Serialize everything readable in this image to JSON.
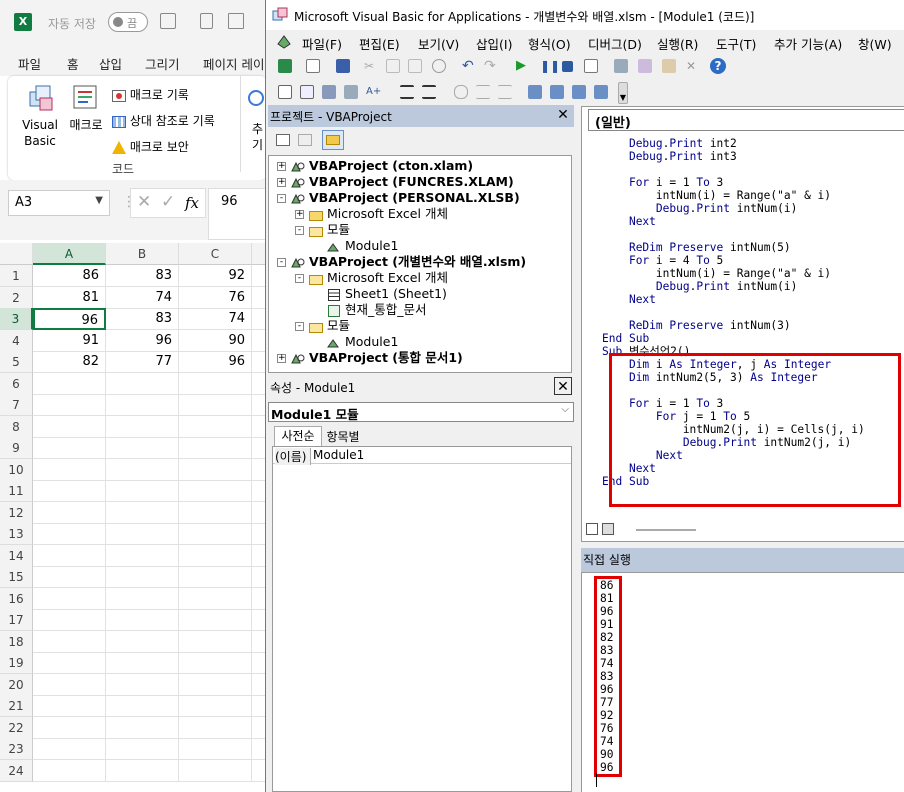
{
  "excel": {
    "autosave_label": "자동 저장",
    "autosave_state": "끔",
    "tabs": [
      "파일",
      "홈",
      "삽입",
      "그리기",
      "페이지 레이"
    ],
    "ribbon": {
      "visual_basic": [
        "Visual",
        "Basic"
      ],
      "macro": "매크로",
      "record_macro": "매크로 기록",
      "relative_ref": "상대 참조로 기록",
      "macro_security": "매크로 보안",
      "group_label": "코드",
      "cut_label_1": "추",
      "cut_label_2": "기"
    },
    "name_box": "A3",
    "fx": "fx",
    "formula_value": "96",
    "columns": [
      "A",
      "B",
      "C"
    ],
    "rows": [
      "1",
      "2",
      "3",
      "4",
      "5",
      "6",
      "7",
      "8",
      "9",
      "10",
      "11",
      "12",
      "13",
      "14",
      "15",
      "16",
      "17",
      "18",
      "19",
      "20",
      "21",
      "22",
      "23",
      "24"
    ],
    "cells": [
      [
        "86",
        "83",
        "92"
      ],
      [
        "81",
        "74",
        "76"
      ],
      [
        "96",
        "83",
        "74"
      ],
      [
        "91",
        "96",
        "90"
      ],
      [
        "82",
        "77",
        "96"
      ]
    ]
  },
  "vbe": {
    "title": "Microsoft Visual Basic for Applications - 개별변수와 배열.xlsm - [Module1 (코드)]",
    "menu": [
      "파일(F)",
      "편집(E)",
      "보기(V)",
      "삽입(I)",
      "형식(O)",
      "디버그(D)",
      "실행(R)",
      "도구(T)",
      "추가 기능(A)",
      "창(W)"
    ],
    "project_title": "프로젝트 - VBAProject",
    "tree": [
      {
        "label": "VBAProject (cton.xlam)",
        "level": 0,
        "bold": true,
        "pm": "+",
        "icon": "vbaproject-icon"
      },
      {
        "label": "VBAProject (FUNCRES.XLAM)",
        "level": 0,
        "bold": true,
        "pm": "+",
        "icon": "vbaproject-icon"
      },
      {
        "label": "VBAProject (PERSONAL.XLSB)",
        "level": 0,
        "bold": true,
        "pm": "-",
        "icon": "vbaproject-icon"
      },
      {
        "label": "Microsoft Excel 개체",
        "level": 1,
        "bold": false,
        "pm": "+",
        "icon": "folder-icon"
      },
      {
        "label": "모듈",
        "level": 1,
        "bold": false,
        "pm": "-",
        "icon": "folder-open-icon"
      },
      {
        "label": "Module1",
        "level": 2,
        "bold": false,
        "pm": "",
        "icon": "module-icon"
      },
      {
        "label": "VBAProject (개별변수와 배열.xlsm)",
        "level": 0,
        "bold": true,
        "pm": "-",
        "icon": "vbaproject-icon"
      },
      {
        "label": "Microsoft Excel 개체",
        "level": 1,
        "bold": false,
        "pm": "-",
        "icon": "folder-open-icon"
      },
      {
        "label": "Sheet1 (Sheet1)",
        "level": 2,
        "bold": false,
        "pm": "",
        "icon": "sheet-icon"
      },
      {
        "label": "현재_통합_문서",
        "level": 2,
        "bold": false,
        "pm": "",
        "icon": "workbook-icon"
      },
      {
        "label": "모듈",
        "level": 1,
        "bold": false,
        "pm": "-",
        "icon": "folder-open-icon"
      },
      {
        "label": "Module1",
        "level": 2,
        "bold": false,
        "pm": "",
        "icon": "module-icon"
      },
      {
        "label": "VBAProject (통합 문서1)",
        "level": 0,
        "bold": true,
        "pm": "+",
        "icon": "vbaproject-icon"
      }
    ],
    "props_title": "속성 - Module1",
    "props_combo": "Module1 모듈",
    "props_tabs": [
      "사전순",
      "항목별"
    ],
    "props_row": {
      "name": "(이름)",
      "value": "Module1"
    },
    "code_combo": "(일반)",
    "code_lines": [
      "    Debug.Print int2",
      "    Debug.Print int3",
      "",
      "    For i = 1 To 3",
      "        intNum(i) = Range(\"a\" & i)",
      "        Debug.Print intNum(i)",
      "    Next",
      "",
      "    ReDim Preserve intNum(5)",
      "    For i = 4 To 5",
      "        intNum(i) = Range(\"a\" & i)",
      "        Debug.Print intNum(i)",
      "    Next",
      "",
      "    ReDim Preserve intNum(3)",
      "End Sub",
      "Sub 변수선언2()",
      "    Dim i As Integer, j As Integer",
      "    Dim intNum2(5, 3) As Integer",
      "",
      "    For i = 1 To 3",
      "        For j = 1 To 5",
      "            intNum2(j, i) = Cells(j, i)",
      "            Debug.Print intNum2(j, i)",
      "        Next",
      "    Next",
      "End Sub"
    ],
    "immediate_title": "직접 실행",
    "immediate_output": [
      "86",
      "81",
      "96",
      "91",
      "82",
      "83",
      "74",
      "83",
      "96",
      "77",
      "92",
      "76",
      "74",
      "90",
      "96"
    ]
  }
}
